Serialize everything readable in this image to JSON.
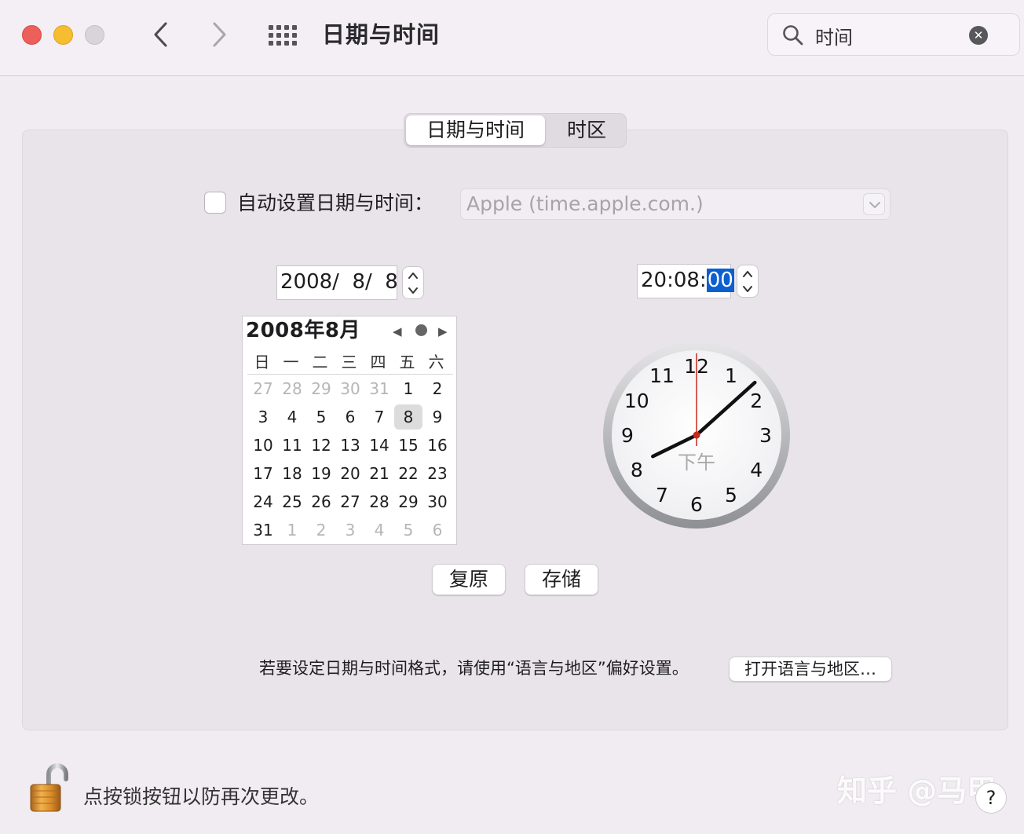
{
  "toolbar": {
    "title": "日期与时间",
    "search": {
      "value": "时间"
    }
  },
  "tabs": [
    {
      "label": "日期与时间",
      "active": true
    },
    {
      "label": "时区",
      "active": false
    }
  ],
  "auto_set": {
    "label": "自动设置日期与时间：",
    "checked": false,
    "server": "Apple (time.apple.com.)"
  },
  "date_field": "2008/  8/  8",
  "time_field": {
    "prefix": "20:08:",
    "selected": "00"
  },
  "calendar": {
    "title": "2008年8月",
    "weekdays": [
      "日",
      "一",
      "二",
      "三",
      "四",
      "五",
      "六"
    ],
    "weeks": [
      [
        "27",
        "28",
        "29",
        "30",
        "31",
        "1",
        "2"
      ],
      [
        "3",
        "4",
        "5",
        "6",
        "7",
        "8",
        "9"
      ],
      [
        "10",
        "11",
        "12",
        "13",
        "14",
        "15",
        "16"
      ],
      [
        "17",
        "18",
        "19",
        "20",
        "21",
        "22",
        "23"
      ],
      [
        "24",
        "25",
        "26",
        "27",
        "28",
        "29",
        "30"
      ],
      [
        "31",
        "1",
        "2",
        "3",
        "4",
        "5",
        "6"
      ]
    ],
    "selected_day": "8"
  },
  "clock": {
    "hour": 20,
    "minute": 8,
    "second": 0,
    "period": "下午",
    "numerals": [
      "12",
      "1",
      "2",
      "3",
      "4",
      "5",
      "6",
      "7",
      "8",
      "9",
      "10",
      "11"
    ]
  },
  "buttons": {
    "revert": "复原",
    "save": "存储"
  },
  "format_note": "若要设定日期与时间格式，请使用“语言与地区”偏好设置。",
  "open_language_button": "打开语言与地区…",
  "lock_text": "点按锁按钮以防再次更改。",
  "watermark": "知乎 @马甲",
  "help": "?"
}
